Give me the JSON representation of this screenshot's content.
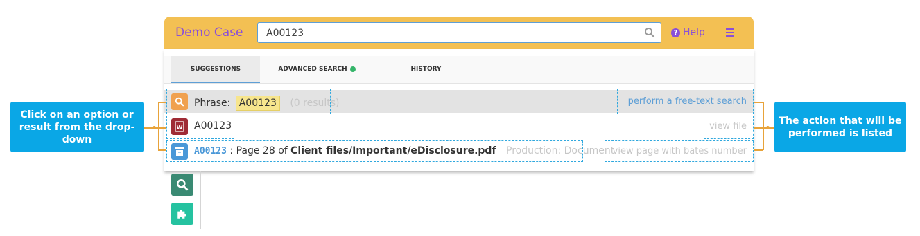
{
  "app": {
    "title": "Demo Case",
    "search_value": "A00123",
    "help_label": "Help"
  },
  "tabs": [
    {
      "label": "SUGGESTIONS",
      "active": true
    },
    {
      "label": "ADVANCED SEARCH",
      "status_color": "#35b56a"
    },
    {
      "label": "HISTORY"
    }
  ],
  "suggestions": {
    "phrase": {
      "label": "Phrase:",
      "value": "A00123",
      "count": "(0 results)",
      "action": "perform a free-text search",
      "icon": "search-icon"
    },
    "document": {
      "name": "A00123",
      "action": "view file",
      "icon": "word-document-icon"
    },
    "page": {
      "bates": "A00123",
      "sep": ": Page 28 of",
      "path": "Client files/Important/eDisclosure.pdf",
      "tag": "Production: Document",
      "action": "view page with bates number",
      "icon": "archive-box-icon"
    }
  },
  "callouts": {
    "left": "Click on an option or result from the drop-down",
    "right": "The action that will be performed is listed"
  },
  "colors": {
    "topbar": "#f3c053",
    "accent_purple": "#8a4fd8",
    "callout_blue": "#0aa7e6",
    "connector_orange": "#e8a33a"
  }
}
